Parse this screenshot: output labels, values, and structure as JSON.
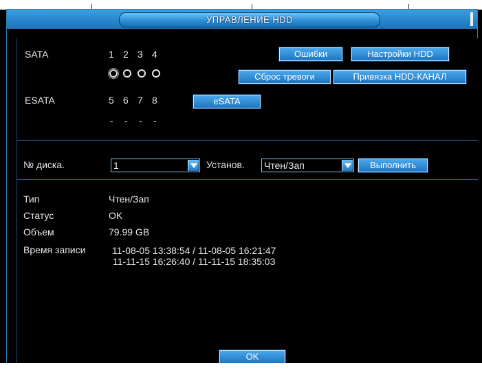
{
  "window": {
    "title": "УПРАВЛЕНИЕ HDD"
  },
  "sata": {
    "label": "SATA",
    "numbers": [
      "1",
      "2",
      "3",
      "4"
    ]
  },
  "esata": {
    "label": "ESATA",
    "numbers": [
      "5",
      "6",
      "7",
      "8"
    ],
    "dashes": [
      "-",
      "-",
      "-",
      "-"
    ]
  },
  "buttons": {
    "errors": "Ошибки",
    "hdd_settings": "Настройки HDD",
    "reset_alarm": "Сброс тревоги",
    "hdd_channel": "Привязка HDD-КАНАЛ",
    "esata": "eSATA",
    "execute": "Выполнить",
    "ok": "OK"
  },
  "controls": {
    "disk_label": "№ диска.",
    "disk_value": "1",
    "set_label": "Установ.",
    "set_value": "Чтен/Зап"
  },
  "info": {
    "type_label": "Тип",
    "type_value": "Чтен/Зап",
    "status_label": "Статус",
    "status_value": "OK",
    "volume_label": "Объем",
    "volume_value": "79.99 GB",
    "record_label": "Время записи",
    "record_line1": "11-08-05 13:38:54 / 11-08-05 16:21:47",
    "record_line2": "11-11-15 16:26:40 / 11-11-15 18:35:03"
  }
}
